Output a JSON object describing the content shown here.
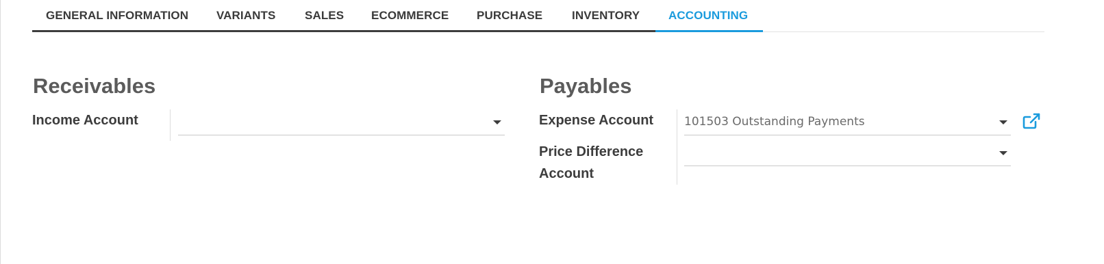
{
  "tabs": [
    {
      "label": "GENERAL INFORMATION"
    },
    {
      "label": "VARIANTS"
    },
    {
      "label": "SALES"
    },
    {
      "label": "ECOMMERCE"
    },
    {
      "label": "PURCHASE"
    },
    {
      "label": "INVENTORY"
    },
    {
      "label": "ACCOUNTING"
    }
  ],
  "active_tab": "ACCOUNTING",
  "colors": {
    "accent": "#1a9bdd",
    "text": "#3d3d3d",
    "heading": "#5b5b5b"
  },
  "receivables": {
    "title": "Receivables",
    "income_account": {
      "label": "Income Account",
      "value": ""
    }
  },
  "payables": {
    "title": "Payables",
    "expense_account": {
      "label": "Expense Account",
      "value": "101503 Outstanding Payments"
    },
    "price_difference_account": {
      "label_line1": "Price Difference",
      "label_line2": "Account",
      "value": ""
    }
  },
  "icons": {
    "dropdown": "caret-down-icon",
    "external": "external-link-icon"
  }
}
